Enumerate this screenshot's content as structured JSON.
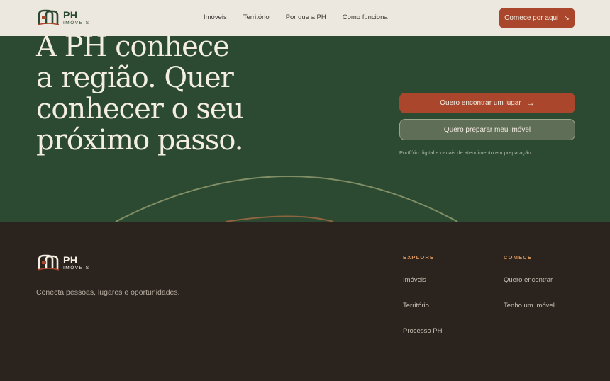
{
  "header": {
    "logo": {
      "ph": "PH",
      "sub": "IMÓVEIS"
    },
    "nav": [
      "Imóveis",
      "Território",
      "Por que a PH",
      "Como funciona"
    ],
    "cta": {
      "label": "Comece por aqui",
      "icon": "arrow-down-right-icon"
    }
  },
  "hero": {
    "title_lines": [
      "A PH conhece",
      "a região. Quer",
      "conhecer o seu",
      "próximo passo."
    ],
    "primary_cta": {
      "label": "Quero encontrar um lugar",
      "icon": "arrow-right-icon"
    },
    "secondary_cta": {
      "label": "Quero preparar meu imóvel"
    },
    "note": "Portfólio digital e canais de atendimento em preparação."
  },
  "footer": {
    "logo": {
      "ph": "PH",
      "sub": "IMÓVEIS"
    },
    "tagline": "Conecta pessoas, lugares e oportunidades.",
    "explore": {
      "title": "EXPLORE",
      "links": [
        "Imóveis",
        "Território",
        "Processo PH"
      ]
    },
    "comece": {
      "title": "COMECE",
      "links": [
        "Quero encontrar",
        "Tenho um imóvel"
      ]
    }
  },
  "colors": {
    "hero_bg": "#2c4a31",
    "header_bg": "#ece7df",
    "accent": "#a9462b",
    "footer_bg": "#2b231d",
    "footer_heading": "#d6955d"
  }
}
